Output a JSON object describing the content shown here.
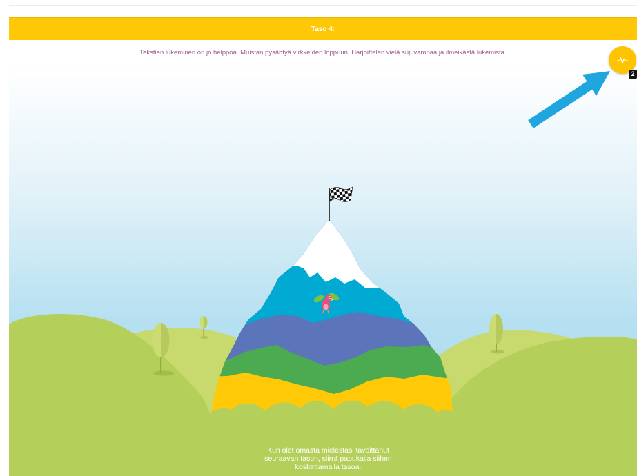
{
  "header": {
    "title": "Taso 4:"
  },
  "level": {
    "description": "Tekstien lukeminen on jo helppoa. Muistan pysähtyä virkkeiden loppuun. Harjoittelen vielä sujuvampaa ja ilmeikästä lukemista."
  },
  "progress_button": {
    "icon": "activity-pulse-icon",
    "badge": "2"
  },
  "instruction": "Kun olet omasta mielestäsi tavoittanut seuraavan tason, siirrä papukaija siihen koskettamalla tasoa.",
  "mountain": {
    "marker": "parrot-icon",
    "summit": "checkered-flag-icon",
    "marker_level": 4,
    "levels": [
      {
        "color": "#ffc907"
      },
      {
        "color": "#4cab50"
      },
      {
        "color": "#5c74ba"
      },
      {
        "color": "#00aad2"
      },
      {
        "color": "#ffffff"
      }
    ]
  },
  "colors": {
    "accent": "#ffc807",
    "description_text": "#9e5b8f",
    "arrow": "#1fa6df",
    "sky_top": "#ffffff",
    "sky_bottom": "#a4d9ee",
    "hills": "#b5cf5b",
    "hills_back": "#c8d96d",
    "tree": "#cbdc72"
  }
}
